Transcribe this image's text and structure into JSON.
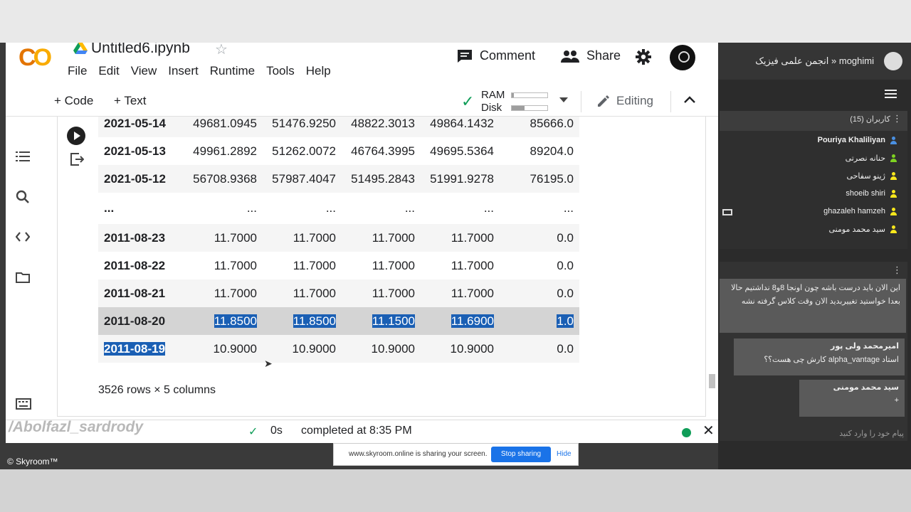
{
  "colab": {
    "title": "Untitled6.ipynb",
    "menu": [
      "File",
      "Edit",
      "View",
      "Insert",
      "Runtime",
      "Tools",
      "Help"
    ],
    "comment_label": "Comment",
    "share_label": "Share",
    "add_code_label": "+ Code",
    "add_text_label": "+ Text",
    "ram_label": "RAM",
    "disk_label": "Disk",
    "ram_usage": 0.05,
    "disk_usage": 0.35,
    "editing_label": "Editing"
  },
  "dataframe": {
    "rows": [
      [
        "2021-05-14",
        "49681.0945",
        "51476.9250",
        "48822.3013",
        "49864.1432",
        "85666.0"
      ],
      [
        "2021-05-13",
        "49961.2892",
        "51262.0072",
        "46764.3995",
        "49695.5364",
        "89204.0"
      ],
      [
        "2021-05-12",
        "56708.9368",
        "57987.4047",
        "51495.2843",
        "51991.9278",
        "76195.0"
      ],
      [
        "...",
        "...",
        "...",
        "...",
        "...",
        "..."
      ],
      [
        "2011-08-23",
        "11.7000",
        "11.7000",
        "11.7000",
        "11.7000",
        "0.0"
      ],
      [
        "2011-08-22",
        "11.7000",
        "11.7000",
        "11.7000",
        "11.7000",
        "0.0"
      ],
      [
        "2011-08-21",
        "11.7000",
        "11.7000",
        "11.7000",
        "11.7000",
        "0.0"
      ],
      [
        "2011-08-20",
        "11.8500",
        "11.8500",
        "11.1500",
        "11.6900",
        "1.0"
      ],
      [
        "2011-08-19",
        "10.9000",
        "10.9000",
        "10.9000",
        "10.9000",
        "0.0"
      ]
    ],
    "summary": "3526 rows × 5 columns"
  },
  "status": {
    "elapsed": "0s",
    "message": "completed at 8:35 PM"
  },
  "watermark": "/Abolfazl_sardrody",
  "skyroom_copyright": "© Skyroom™",
  "share_banner": {
    "text": "www.skyroom.online is sharing your screen.",
    "stop_label": "Stop sharing",
    "hide_label": "Hide"
  },
  "skyroom": {
    "header_user": "moghimi « انجمن علمی فیزیک",
    "users_title": "کاربران (15)",
    "users": [
      {
        "name": "Pouriya Khaliliyan",
        "color": "#4a90e2"
      },
      {
        "name": "حنانه نصرتی",
        "color": "#7ed321"
      },
      {
        "name": "ژینو سفاحی",
        "color": "#f8e71c"
      },
      {
        "name": "shoeib shiri",
        "color": "#f8e71c"
      },
      {
        "name": "ghazaleh hamzeh",
        "color": "#f8e71c"
      },
      {
        "name": "سید محمد مومنی",
        "color": "#f8e71c"
      }
    ],
    "messages": [
      {
        "text": "این الان باید درست باشه چون اونجا 8و8 نداشتیم حالا بعدا خواستید تغییربدید الان وقت کلاس گرفته نشه"
      },
      {
        "who": "امیرمحمد ولی پور",
        "text": "استاد alpha_vantage کارش چی هست؟؟"
      },
      {
        "who": "سید محمد مومنی",
        "text": "+"
      }
    ],
    "input_placeholder": "پیام خود را وارد کنید"
  }
}
